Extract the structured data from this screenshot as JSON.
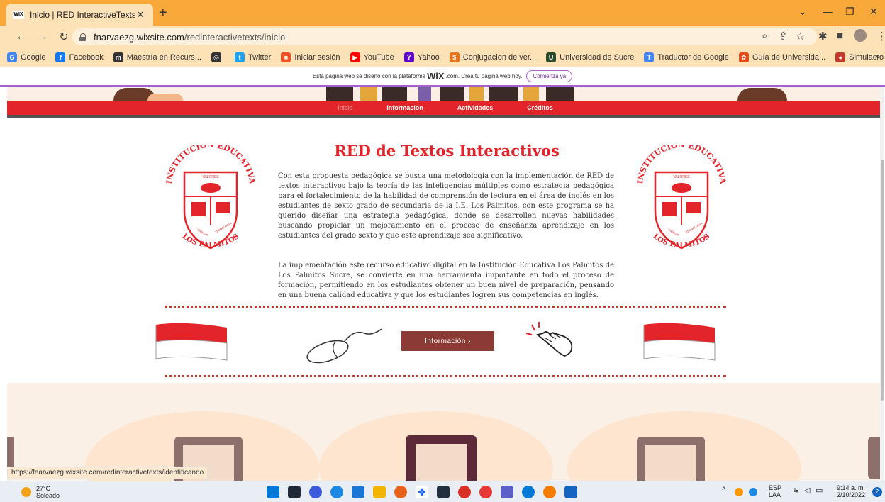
{
  "browser": {
    "tab_title": "Inicio | RED InteractiveTexts",
    "favicon_text": "WIX",
    "new_tab": "+",
    "url_host": "fnarvaezg.wixsite.com",
    "url_path": "/redinteractivetexts/inicio"
  },
  "bookmarks": [
    {
      "label": "Google",
      "color": "#4285f4",
      "glyph": "G"
    },
    {
      "label": "Facebook",
      "color": "#1877f2",
      "glyph": "f"
    },
    {
      "label": "Maestría en Recurs...",
      "color": "#333333",
      "glyph": "m"
    },
    {
      "label": "",
      "color": "#333333",
      "glyph": "◎"
    },
    {
      "label": "Twitter",
      "color": "#1da1f2",
      "glyph": "t"
    },
    {
      "label": "Iniciar sesión",
      "color": "#f25022",
      "glyph": "■"
    },
    {
      "label": "YouTube",
      "color": "#ff0000",
      "glyph": "▶"
    },
    {
      "label": "Yahoo",
      "color": "#6001d2",
      "glyph": "Y"
    },
    {
      "label": "Conjugacion de ver...",
      "color": "#e8711b",
      "glyph": "$"
    },
    {
      "label": "Universidad de Sucre",
      "color": "#2b4a2a",
      "glyph": "U"
    },
    {
      "label": "Traductor de Google",
      "color": "#4285f4",
      "glyph": "T"
    },
    {
      "label": "Guía de Universida...",
      "color": "#e64a19",
      "glyph": "✿"
    },
    {
      "label": "Simulacro Ecaes -...",
      "color": "#c0392b",
      "glyph": "●"
    }
  ],
  "bookmarks_more": "»",
  "wix_banner": {
    "text_before": "Esta página web se diseñó con la plataforma",
    "logo": "WiX",
    "text_after": ".com. Crea tu página web hoy.",
    "cta": "Comienza ya"
  },
  "menu": {
    "items": [
      "Inicio",
      "Información",
      "Actividades",
      "Créditos"
    ]
  },
  "content": {
    "title": "RED de Textos Interactivos",
    "paragraph1": "Con esta propuesta pedagógica se busca una metodología con la implementación de RED de textos interactivos bajo la teoría de las inteligencias múltiples como estrategia pedagógica para el fortalecimiento de la habilidad de comprensión de lectura en el área de inglés en los estudiantes de sexto grado de secundaria de la I.E. Los Palmitos, con este programa se ha querido diseñar una estrategia pedagógica, donde se desarrollen nuevas habilidades buscando propiciar un mejoramiento en el proceso de enseñanza aprendizaje en los estudiantes del grado sexto y que este aprendizaje sea significativo.",
    "paragraph2": "La implementación este recurso educativo digital en la Institución Educativa Los Palmitos de Los Palmitos Sucre, se convierte en una herramienta importante en todo el proceso de formación, permitiendo en los estudiantes obtener un buen nivel de preparación, pensando en una buena calidad educativa y que los estudiantes logren sus competencias en inglés.",
    "crest": {
      "top_text": "INSTITUCION EDUCATIVA",
      "bottom_text": "LOS PALMITOS",
      "motto": "VALORES",
      "left_band": "CIENCIA",
      "right_band": "TECNOLOGIA"
    },
    "info_button": "Información ›"
  },
  "status_url": "https://fnarvaezg.wixsite.com/redinteractivetexts/identificando",
  "taskbar": {
    "temperature": "27°C",
    "weather": "Soleado",
    "lang_top": "ESP",
    "lang_bottom": "LAA",
    "time": "9:14 a. m.",
    "date": "2/10/2022",
    "notification_count": "2"
  },
  "colors": {
    "accent_red": "#e3242b",
    "button_brown": "#8b3a35",
    "chrome_orange": "#f9a93a"
  }
}
